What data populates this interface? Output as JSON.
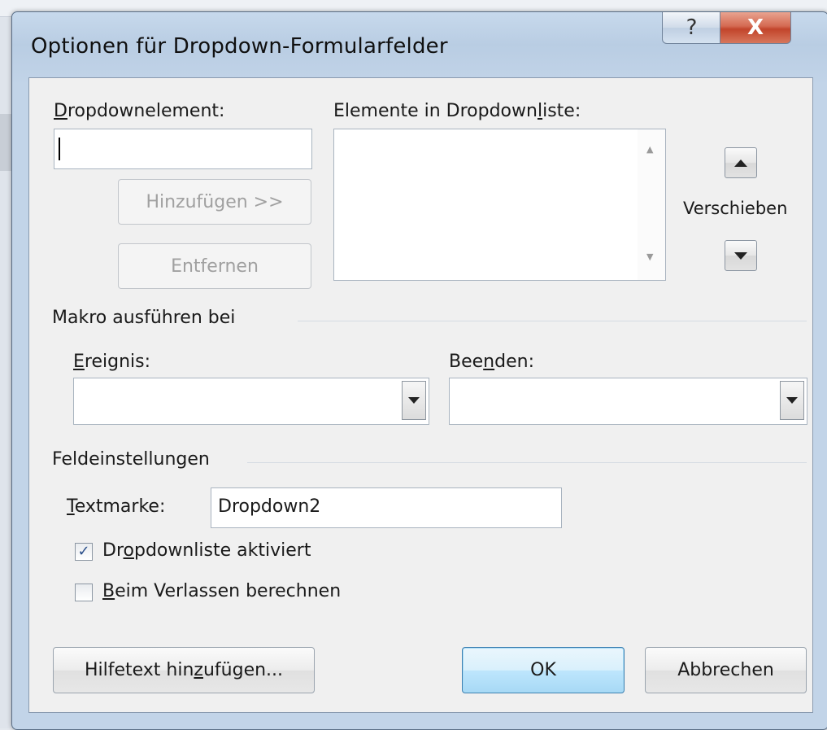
{
  "dialog": {
    "title": "Optionen für Dropdown-Formularfelder",
    "help_glyph": "?",
    "close_glyph": "X"
  },
  "dropdown_element": {
    "label_accel": "D",
    "label_rest": "ropdownelement:",
    "value": ""
  },
  "list": {
    "label_pre": "Elemente in Dropdown",
    "label_accel": "l",
    "label_post": "iste:",
    "items": []
  },
  "buttons": {
    "add": "Hinzufügen >>",
    "remove": "Entfernen",
    "move": "Verschieben",
    "help_pre": "Hilfetext hin",
    "help_accel": "z",
    "help_post": "ufügen...",
    "ok": "OK",
    "cancel": "Abbrechen"
  },
  "macro": {
    "section": "Makro ausführen bei",
    "entry_accel": "E",
    "entry_rest": "reignis:",
    "entry_value": "",
    "exit_pre": "Bee",
    "exit_accel": "n",
    "exit_post": "den:",
    "exit_value": ""
  },
  "settings": {
    "section": "Feldeinstellungen",
    "bookmark_accel": "T",
    "bookmark_rest": "extmarke:",
    "bookmark_value": "Dropdown2",
    "enabled_pre": "Dr",
    "enabled_accel": "o",
    "enabled_post": "pdownliste aktiviert",
    "enabled_checked": true,
    "calc_accel": "B",
    "calc_rest": "eim Verlassen berechnen",
    "calc_checked": false
  }
}
